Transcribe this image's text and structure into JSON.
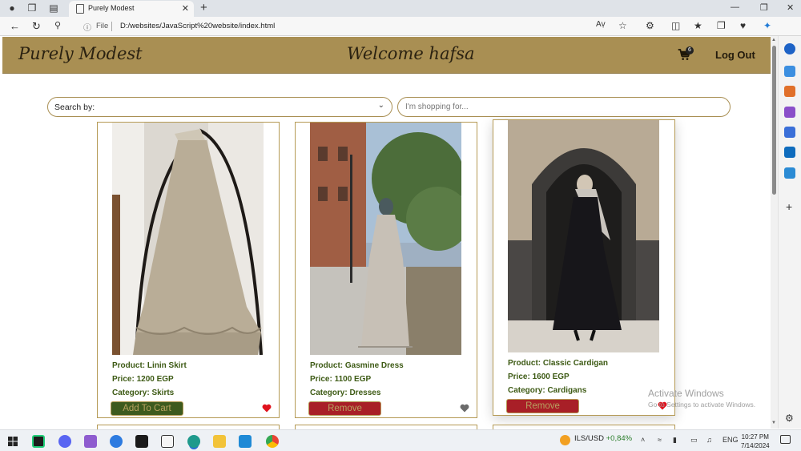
{
  "browser": {
    "tab_title": "Purely Modest",
    "url_scheme": "File",
    "url": "D:/websites/JavaScript%20website/index.html"
  },
  "header": {
    "brand": "Purely Modest",
    "welcome": "Welcome hafsa",
    "cart_count": "6",
    "logout_label": "Log Out"
  },
  "search": {
    "select_label": "Search by:",
    "input_placeholder": "I'm shopping for..."
  },
  "products": [
    {
      "product": "Product: Linin Skirt",
      "price": "Price: 1200 EGP",
      "category": "Category: Skirts",
      "button": "Add To Cart",
      "favorite": true
    },
    {
      "product": "Product: Gasmine Dress",
      "price": "Price: 1100 EGP",
      "category": "Category: Dresses",
      "button": "Remove",
      "favorite": false
    },
    {
      "product": "Product: Classic Cardigan",
      "price": "Price: 1600 EGP",
      "category": "Category: Cardigans",
      "button": "Remove",
      "favorite": true
    }
  ],
  "watermark": {
    "title": "Activate Windows",
    "subtitle": "Go to Settings to activate Windows."
  },
  "taskbar": {
    "ticker_label": "ILS/USD",
    "ticker_change": "+0,84%",
    "language": "ENG",
    "time": "10:27 PM",
    "date": "7/14/2024"
  },
  "colors": {
    "header_bg": "#a98f53",
    "accent_border": "#b59a55",
    "text_green": "#3d5a14",
    "add_button": "#3d5a1e",
    "remove_button": "#a81f27",
    "heart_active": "#e0121d",
    "heart_inactive": "#6b6b6b"
  }
}
